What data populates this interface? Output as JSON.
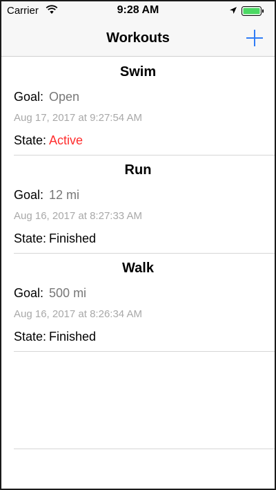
{
  "status_bar": {
    "carrier": "Carrier",
    "time": "9:28 AM",
    "icons": [
      "wifi-icon",
      "location-icon",
      "battery-icon"
    ],
    "battery_color": "#4cd964"
  },
  "nav": {
    "title": "Workouts",
    "add_icon": "plus-icon",
    "accent_color": "#2f7cf6"
  },
  "workouts": [
    {
      "name": "Swim",
      "goal_label": "Goal:",
      "goal": "Open",
      "date": "Aug 17, 2017 at 9:27:54 AM",
      "state_label": "State:",
      "state": "Active",
      "state_color": "#ff2d2d"
    },
    {
      "name": "Run",
      "goal_label": "Goal:",
      "goal": "12 mi",
      "date": "Aug 16, 2017 at 8:27:33 AM",
      "state_label": "State:",
      "state": "Finished",
      "state_color": "#000000"
    },
    {
      "name": "Walk",
      "goal_label": "Goal:",
      "goal": "500 mi",
      "date": "Aug 16, 2017 at 8:26:34 AM",
      "state_label": "State:",
      "state": "Finished",
      "state_color": "#000000"
    }
  ]
}
